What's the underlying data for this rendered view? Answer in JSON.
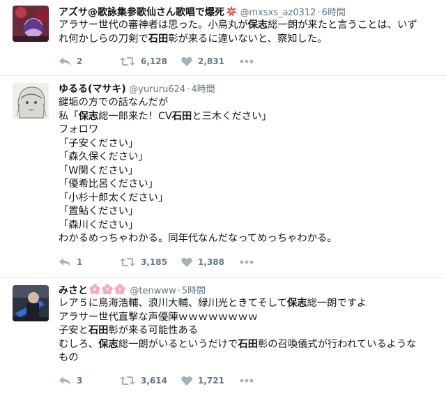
{
  "tweets": [
    {
      "name": "アズサ@歌詠集参歌仙さん歌唱で爆死",
      "name_emoji": "collision-icon",
      "handle": "@mxsxs_az0312",
      "dot": "·",
      "time": "6時間",
      "lines": [
        [
          {
            "t": "アラサー世代の審神者は思った。小烏丸が",
            "b": false
          },
          {
            "t": "保志",
            "b": true
          },
          {
            "t": "総一朗が来たと言うことは、いず",
            "b": false
          }
        ],
        [
          {
            "t": "れ何かしらの刀剣で",
            "b": false
          },
          {
            "t": "石田",
            "b": true
          },
          {
            "t": "彰が来るに違いないと、察知した。",
            "b": false
          }
        ]
      ],
      "replies": "2",
      "retweets": "6,128",
      "likes": "2,831"
    },
    {
      "name": "ゆるる(マサキ)",
      "handle": "@yururu624",
      "dot": "·",
      "time": "4時間",
      "lines": [
        [
          {
            "t": "鍵垢の方での話なんだが",
            "b": false
          }
        ],
        [
          {
            "t": "私「",
            "b": false
          },
          {
            "t": "保志",
            "b": true
          },
          {
            "t": "総一郎来た！CV",
            "b": false
          },
          {
            "t": "石田",
            "b": true
          },
          {
            "t": "と三木ください」",
            "b": false
          }
        ],
        [
          {
            "t": "フォロワ",
            "b": false
          }
        ],
        [
          {
            "t": "「子安ください」",
            "b": false
          }
        ],
        [
          {
            "t": "「森久保ください」",
            "b": false
          }
        ],
        [
          {
            "t": "「W関ください」",
            "b": false
          }
        ],
        [
          {
            "t": "「優希比呂ください」",
            "b": false
          }
        ],
        [
          {
            "t": "「小杉十郎太ください」",
            "b": false
          }
        ],
        [
          {
            "t": "「置鮎ください」",
            "b": false
          }
        ],
        [
          {
            "t": "「森川ください」",
            "b": false
          }
        ],
        [
          {
            "t": "わかるめっちゃわかる。同年代なんだなってめっちゃわかる。",
            "b": false
          }
        ]
      ],
      "replies": "1",
      "retweets": "3,185",
      "likes": "1,388"
    },
    {
      "name": "みさと",
      "name_emoji": "flower-icons",
      "handle": "@tenwww",
      "dot": "·",
      "time": "5時間",
      "lines": [
        [
          {
            "t": "レア５に鳥海浩輔、浪川大輔、緑川光ときてそして",
            "b": false
          },
          {
            "t": "保志",
            "b": true
          },
          {
            "t": "総一朗ですよ",
            "b": false
          }
        ],
        [
          {
            "t": "アラサー世代直撃な声優陣ｗｗｗｗｗｗｗｗ",
            "b": false
          }
        ],
        [
          {
            "t": "子安と",
            "b": false
          },
          {
            "t": "石田",
            "b": true
          },
          {
            "t": "彰が来る可能性ある",
            "b": false
          }
        ],
        [
          {
            "t": "むしろ、",
            "b": false
          },
          {
            "t": "保志",
            "b": true
          },
          {
            "t": "総一朗がいるというだけで",
            "b": false
          },
          {
            "t": "石田",
            "b": true
          },
          {
            "t": "彰の召喚儀式が行われているような",
            "b": false
          }
        ],
        [
          {
            "t": "もの",
            "b": false
          }
        ]
      ],
      "replies": "3",
      "retweets": "3,614",
      "likes": "1,721"
    }
  ],
  "colors": {
    "text": "#14171a",
    "muted": "#657786",
    "separator": "#e6ecf0",
    "burst": "#e0245e"
  }
}
